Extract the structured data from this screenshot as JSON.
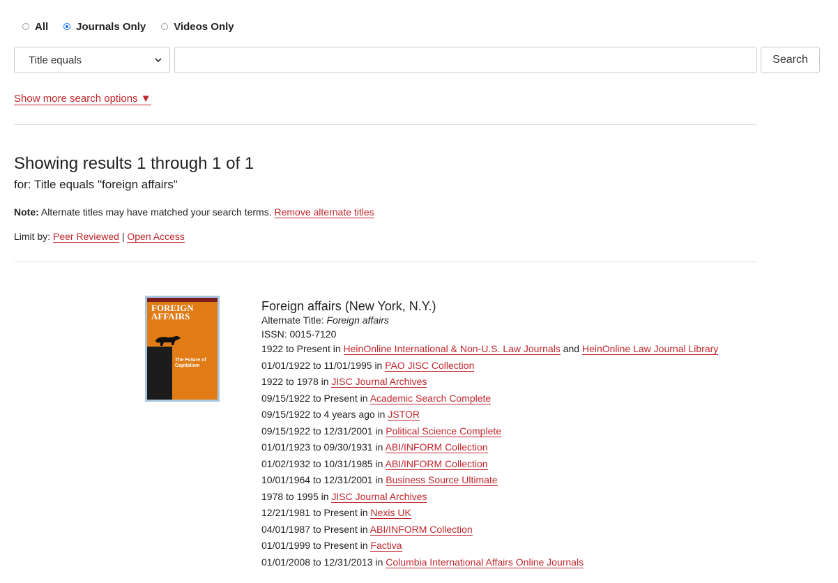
{
  "filters": {
    "all": "All",
    "journals": "Journals Only",
    "videos": "Videos Only"
  },
  "search": {
    "field": "Title equals",
    "value": "",
    "button": "Search",
    "more_options": "Show more search options ▼"
  },
  "results": {
    "heading": "Showing results 1 through 1 of 1",
    "query": "for: Title equals \"foreign affairs\"",
    "note_label": "Note:",
    "note_text": "Alternate titles may have matched your search terms.",
    "note_link": "Remove alternate titles",
    "limit_label": "Limit by:",
    "limit_peer": "Peer Reviewed",
    "limit_sep": "|",
    "limit_open": "Open Access"
  },
  "cover": {
    "title": "FOREIGN AFFAIRS",
    "subtitle": "The Future of Capitalism"
  },
  "entry": {
    "title": "Foreign affairs (New York, N.Y.)",
    "alt_label": "Alternate Title:",
    "alt_title": "Foreign affairs",
    "issn": "ISSN: 0015-7120",
    "first_range": "1922 to Present in",
    "first_db": "HeinOnline International & Non-U.S. Law Journals",
    "first_and": "and",
    "first_db2": "HeinOnline Law Journal Library",
    "holdings": [
      {
        "range": "01/01/1922 to 11/01/1995 in",
        "db": "PAO JISC Collection"
      },
      {
        "range": "1922 to 1978 in",
        "db": "JISC Journal Archives"
      },
      {
        "range": "09/15/1922 to Present in",
        "db": "Academic Search Complete"
      },
      {
        "range": "09/15/1922 to 4 years ago in",
        "db": "JSTOR"
      },
      {
        "range": "09/15/1922 to 12/31/2001 in",
        "db": "Political Science Complete"
      },
      {
        "range": "01/01/1923 to 09/30/1931 in",
        "db": "ABI/INFORM Collection"
      },
      {
        "range": "01/02/1932 to 10/31/1985 in",
        "db": "ABI/INFORM Collection"
      },
      {
        "range": "10/01/1964 to 12/31/2001 in",
        "db": "Business Source Ultimate"
      },
      {
        "range": "1978 to 1995 in",
        "db": "JISC Journal Archives"
      },
      {
        "range": "12/21/1981 to Present in",
        "db": "Nexis UK"
      },
      {
        "range": "04/01/1987 to Present in",
        "db": "ABI/INFORM Collection"
      },
      {
        "range": "01/01/1999 to Present in",
        "db": "Factiva"
      },
      {
        "range": "01/01/2008 to 12/31/2013 in",
        "db": "Columbia International Affairs Online Journals"
      }
    ]
  },
  "colors": {
    "link": "#c0262c",
    "radio_selected": "#1a73e8"
  }
}
